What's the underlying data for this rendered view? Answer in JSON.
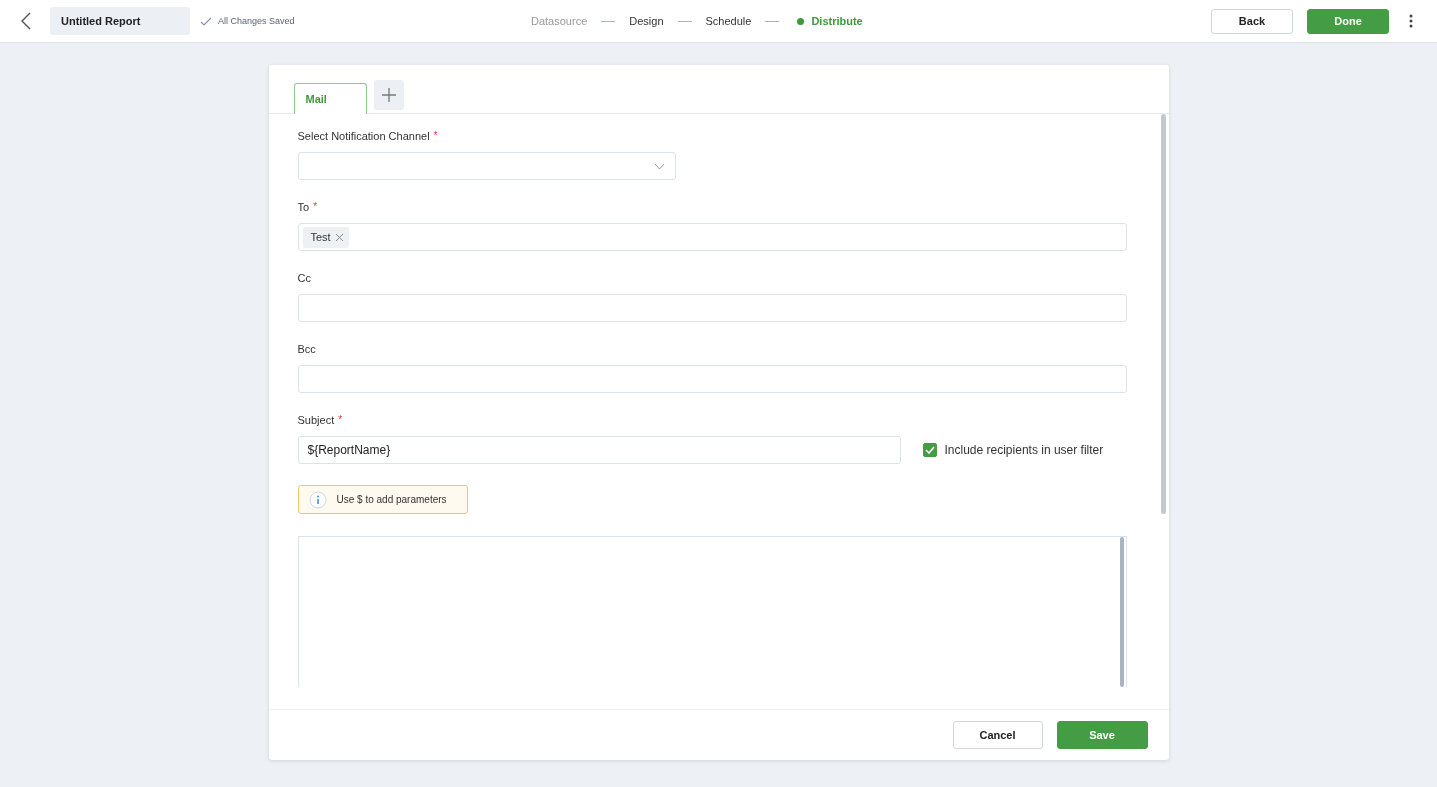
{
  "header": {
    "report_name": "Untitled Report",
    "save_status": "All Changes Saved",
    "steps": [
      {
        "label": "Datasource",
        "selected": false,
        "disabled": true
      },
      {
        "label": "Design",
        "selected": false,
        "disabled": false
      },
      {
        "label": "Schedule",
        "selected": false,
        "disabled": false
      },
      {
        "label": "Distribute",
        "selected": true,
        "disabled": false
      }
    ],
    "buttons": [
      {
        "label": "Back",
        "kind": "secondary"
      },
      {
        "label": "Done",
        "kind": "primary"
      }
    ]
  },
  "tabs": [
    {
      "label": "Mail",
      "selected": true
    }
  ],
  "fields": [
    {
      "label": "Select Notification Channel",
      "required_mark": "*",
      "kind": "select"
    },
    {
      "label": "To",
      "required_mark": "*",
      "kind": "tags",
      "tags": [
        "Test"
      ]
    },
    {
      "label": "Cc",
      "kind": "text"
    },
    {
      "label": "Bcc",
      "kind": "text"
    },
    {
      "label": "Subject",
      "required_mark": "*",
      "kind": "subject",
      "value": "${ReportName}"
    }
  ],
  "include_recipients": {
    "label": "Include recipients in user filter",
    "checked": true
  },
  "hint": "Use $ to add parameters",
  "footer_buttons": [
    {
      "label": "Cancel",
      "kind": "secondary"
    },
    {
      "label": "Save",
      "kind": "primary"
    }
  ]
}
